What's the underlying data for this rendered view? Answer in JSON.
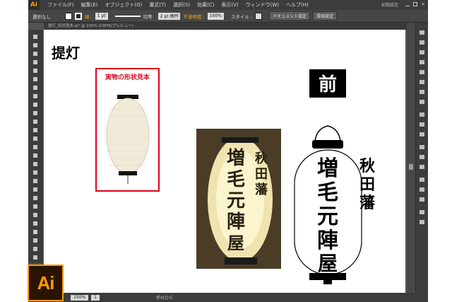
{
  "menubar": {
    "app_logo": "Ai",
    "menus": [
      "ファイル(F)",
      "編集(E)",
      "オブジェクト(O)",
      "書式(T)",
      "選択(S)",
      "効果(C)",
      "表示(V)",
      "ウィンドウ(W)",
      "ヘルプ(H)"
    ],
    "workspace": "初期設定"
  },
  "controlbar": {
    "selection": "選択なし",
    "stroke_label": "線 :",
    "stroke_weight": "1 pt",
    "brush": "均等",
    "brush_size": "2 pt 楕円",
    "opacity_label": "不透明度 :",
    "opacity_value": "100%",
    "style_label": "スタイル :",
    "doc_setup": "ドキュメント設定",
    "preferences": "環境設定"
  },
  "document": {
    "tab_title": "提灯_形状見本.ai* @ 150% (CMYK/プレビュー)"
  },
  "canvas": {
    "heading": "提灯",
    "sample_caption": "実物の形状見本",
    "front_label": "前",
    "lantern_main_text": [
      "増",
      "毛",
      "元",
      "陣",
      "屋"
    ],
    "lantern_side_text": [
      "秋",
      "田",
      "藩"
    ]
  },
  "statusbar": {
    "zoom": "150%",
    "page": "1",
    "tool_name": "手のひら"
  },
  "badge": {
    "text": "Ai"
  },
  "colors": {
    "accent": "#ff9a00",
    "sample_border": "#e0001b",
    "ui_dark": "#3c3c3c"
  }
}
